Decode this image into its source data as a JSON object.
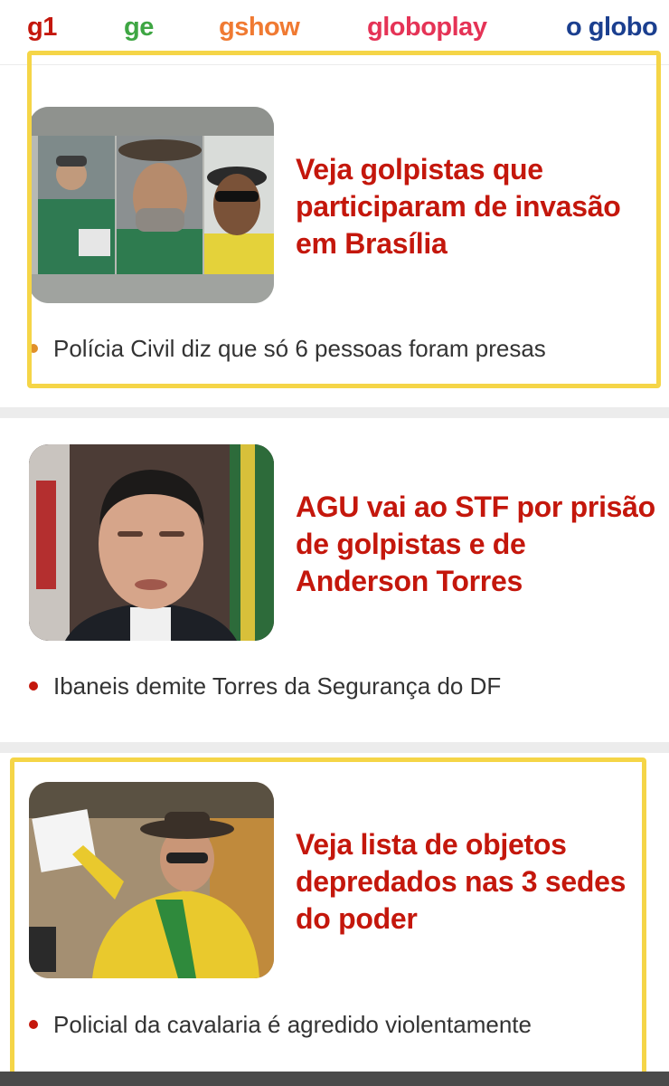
{
  "nav": {
    "items": [
      {
        "label": "g1",
        "color": "#c4170c"
      },
      {
        "label": "ge",
        "color": "#3ea643"
      },
      {
        "label": "gshow",
        "color": "#f07a32"
      },
      {
        "label": "globoplay",
        "color": "#e53356"
      },
      {
        "label": "o globo",
        "color": "#1b3f8f"
      }
    ]
  },
  "articles": [
    {
      "headline": "Veja golpistas que participaram de invasão em Brasília",
      "bullet": "Polícia Civil diz que só 6 pessoas foram presas",
      "image": "collage of three men from videos",
      "bullet_color": "#e0902a",
      "highlighted": true
    },
    {
      "headline": "AGU vai ao STF por prisão de golpistas e de Anderson Torres",
      "bullet": "Ibaneis demite Torres da Segurança do DF",
      "image": "portrait of man in suit",
      "bullet_color": "#c4170c",
      "highlighted": false
    },
    {
      "headline": "Veja lista de objetos depredados nas 3 sedes do poder",
      "bullet": "Policial da cavalaria é agredido violentamente",
      "image": "woman in yellow shirt and hat with flag",
      "bullet_color": "#c4170c",
      "highlighted": true
    }
  ],
  "colors": {
    "headline": "#c4170c",
    "highlight_border": "#f5d547",
    "separator": "#ececec"
  }
}
